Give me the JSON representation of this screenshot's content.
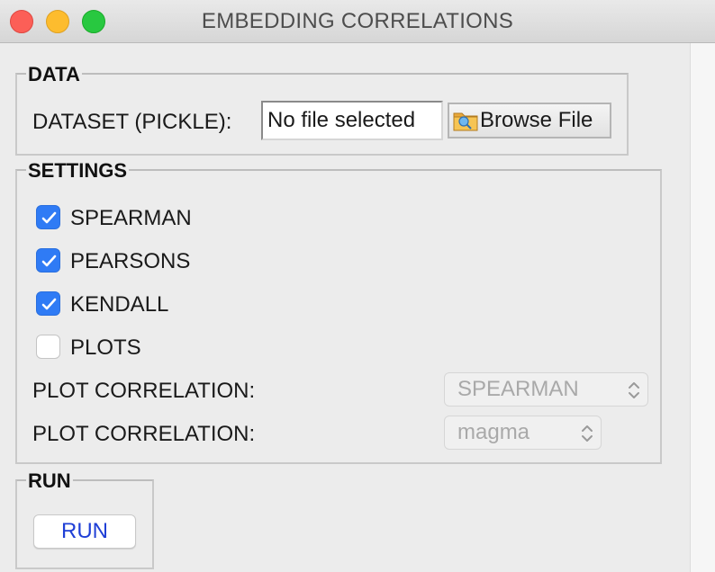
{
  "window": {
    "title": "EMBEDDING CORRELATIONS"
  },
  "data_group": {
    "title": "DATA",
    "dataset_label": "DATASET (PICKLE):",
    "file_value": "No file selected",
    "browse_label": "Browse File"
  },
  "settings_group": {
    "title": "SETTINGS",
    "checkboxes": [
      {
        "label": "SPEARMAN",
        "checked": true
      },
      {
        "label": "PEARSONS",
        "checked": true
      },
      {
        "label": "KENDALL",
        "checked": true
      },
      {
        "label": "PLOTS",
        "checked": false
      }
    ],
    "plot_correlation_label_1": "PLOT CORRELATION:",
    "plot_correlation_value_1": "SPEARMAN",
    "plot_correlation_label_2": "PLOT CORRELATION:",
    "plot_correlation_value_2": "magma"
  },
  "run_group": {
    "title": "RUN",
    "run_label": "RUN"
  },
  "colors": {
    "checkbox_accent": "#2f7bf5",
    "run_text": "#1f3fd6"
  }
}
